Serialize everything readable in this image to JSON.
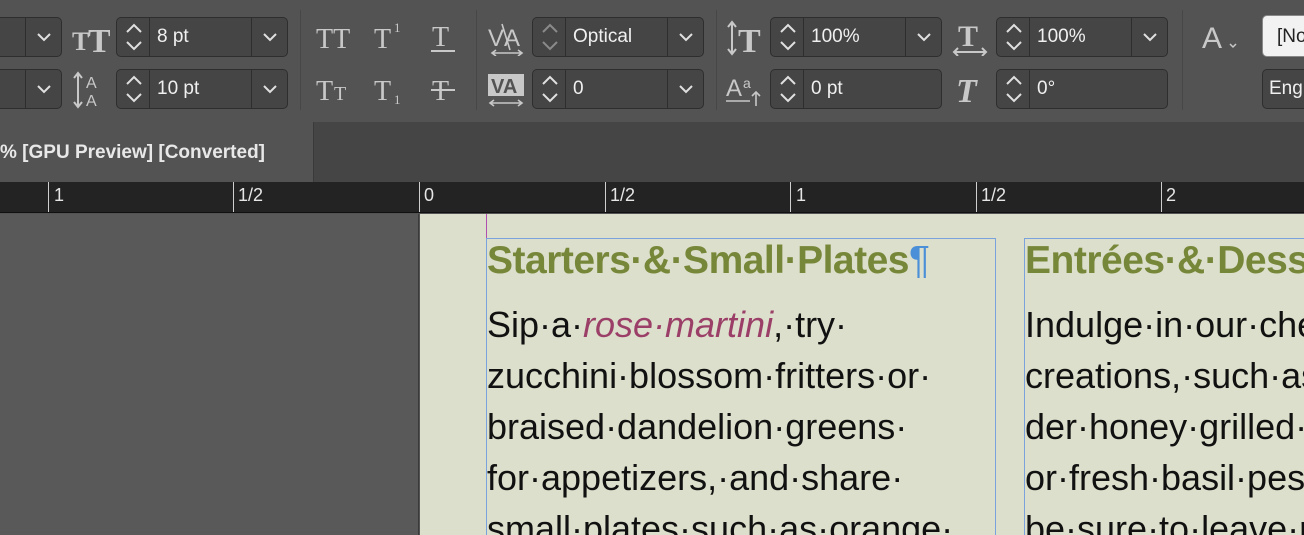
{
  "control_panel": {
    "font_size": "8 pt",
    "leading": "10 pt",
    "kerning": "Optical",
    "tracking": "0",
    "vertical_scale": "100%",
    "horizontal_scale": "100%",
    "baseline_shift": "0 pt",
    "skew": "0°",
    "char_style": "[No",
    "language": "Eng"
  },
  "document": {
    "tab_title": "% [GPU Preview] [Converted]"
  },
  "ruler": {
    "labels": [
      "1",
      "1/2",
      "0",
      "1/2",
      "1",
      "1/2",
      "2"
    ]
  },
  "page": {
    "column1": {
      "heading": "Starters·&·Small·Plates",
      "pilcrow": "¶",
      "lines": [
        {
          "pre": "Sip·a·",
          "accent": "rose·martini",
          "post": ",·try·"
        },
        {
          "pre": "zucchini·blossom·fritters·or·",
          "accent": "",
          "post": ""
        },
        {
          "pre": "braised·dandelion·greens·",
          "accent": "",
          "post": ""
        },
        {
          "pre": "for·appetizers,·and·share·",
          "accent": "",
          "post": ""
        },
        {
          "pre": "small·plates·such·as·orange·",
          "accent": "",
          "post": ""
        }
      ]
    },
    "column2": {
      "heading": "Entrées·&·Desserts",
      "lines": [
        {
          "pre": "Indulge·in·our·chef's·",
          "accent": "",
          "post": ""
        },
        {
          "pre": "creations,·such·as·laven-",
          "accent": "",
          "post": ""
        },
        {
          "pre": "der·honey·grilled·salmon·",
          "accent": "",
          "post": ""
        },
        {
          "pre": "or·fresh·basil·pesto,·and·",
          "accent": "",
          "post": ""
        },
        {
          "pre": "be·sure·to·leave·room·",
          "accent": "",
          "post": ""
        }
      ]
    }
  }
}
